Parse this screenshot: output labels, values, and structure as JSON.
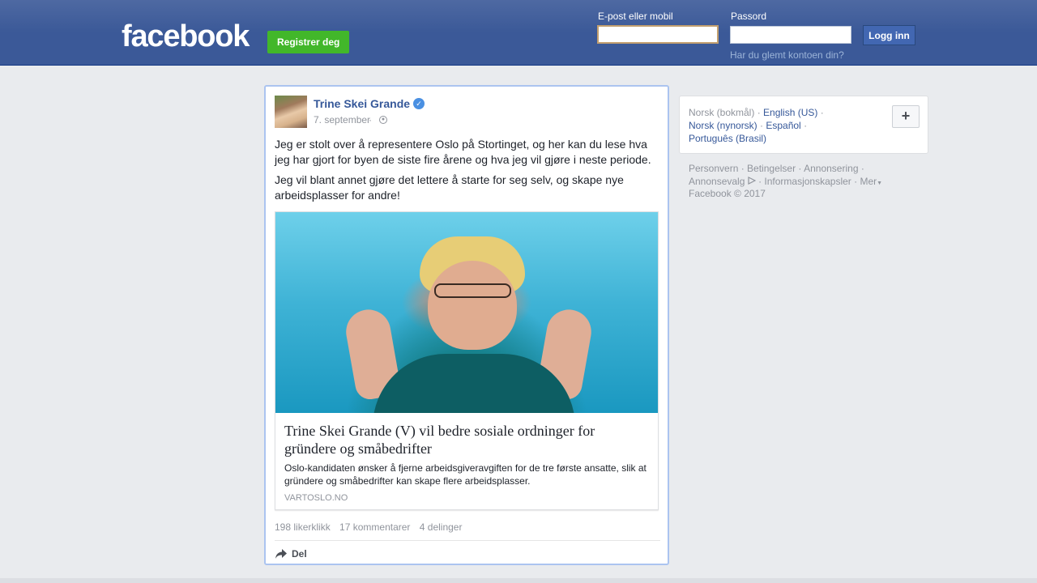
{
  "header": {
    "logo": "facebook",
    "register_label": "Registrer deg",
    "email_label": "E-post eller mobil",
    "email_value": "",
    "password_label": "Passord",
    "password_value": "",
    "login_label": "Logg inn",
    "forgot_label": "Har du glemt kontoen din?"
  },
  "post": {
    "author": "Trine Skei Grande",
    "date": "7. september",
    "paragraphs": [
      "Jeg er stolt over å representere Oslo på Stortinget, og her kan du lese hva jeg har gjort for byen de siste fire årene og hva jeg vil gjøre i neste periode.",
      "Jeg vil blant annet gjøre det lettere å starte for seg selv, og skape nye arbeidsplasser for andre!"
    ],
    "link": {
      "title": "Trine Skei Grande (V) vil bedre sosiale ordninger for gründere og småbedrifter",
      "description": "Oslo-kandidaten ønsker å fjerne arbeidsgiveravgiften for de tre første ansatte, slik at gründere og småbedrifter kan skape flere arbeidsplasser.",
      "domain": "VARTOSLO.NO"
    },
    "stats": {
      "likes": "198 likerklikk",
      "comments": "17 kommentarer",
      "shares": "4 delinger"
    },
    "share_label": "Del"
  },
  "sidebar": {
    "current_language": "Norsk (bokmål)",
    "languages": [
      "English (US)",
      "Norsk (nynorsk)",
      "Español",
      "Português (Brasil)"
    ],
    "footer_links": [
      "Personvern",
      "Betingelser",
      "Annonsering",
      "Annonsevalg",
      "Informasjonskapsler",
      "Mer"
    ],
    "copyright": "Facebook © 2017"
  },
  "colors": {
    "header_blue": "#3b5998",
    "link_blue": "#365899",
    "register_green": "#42b72a"
  }
}
